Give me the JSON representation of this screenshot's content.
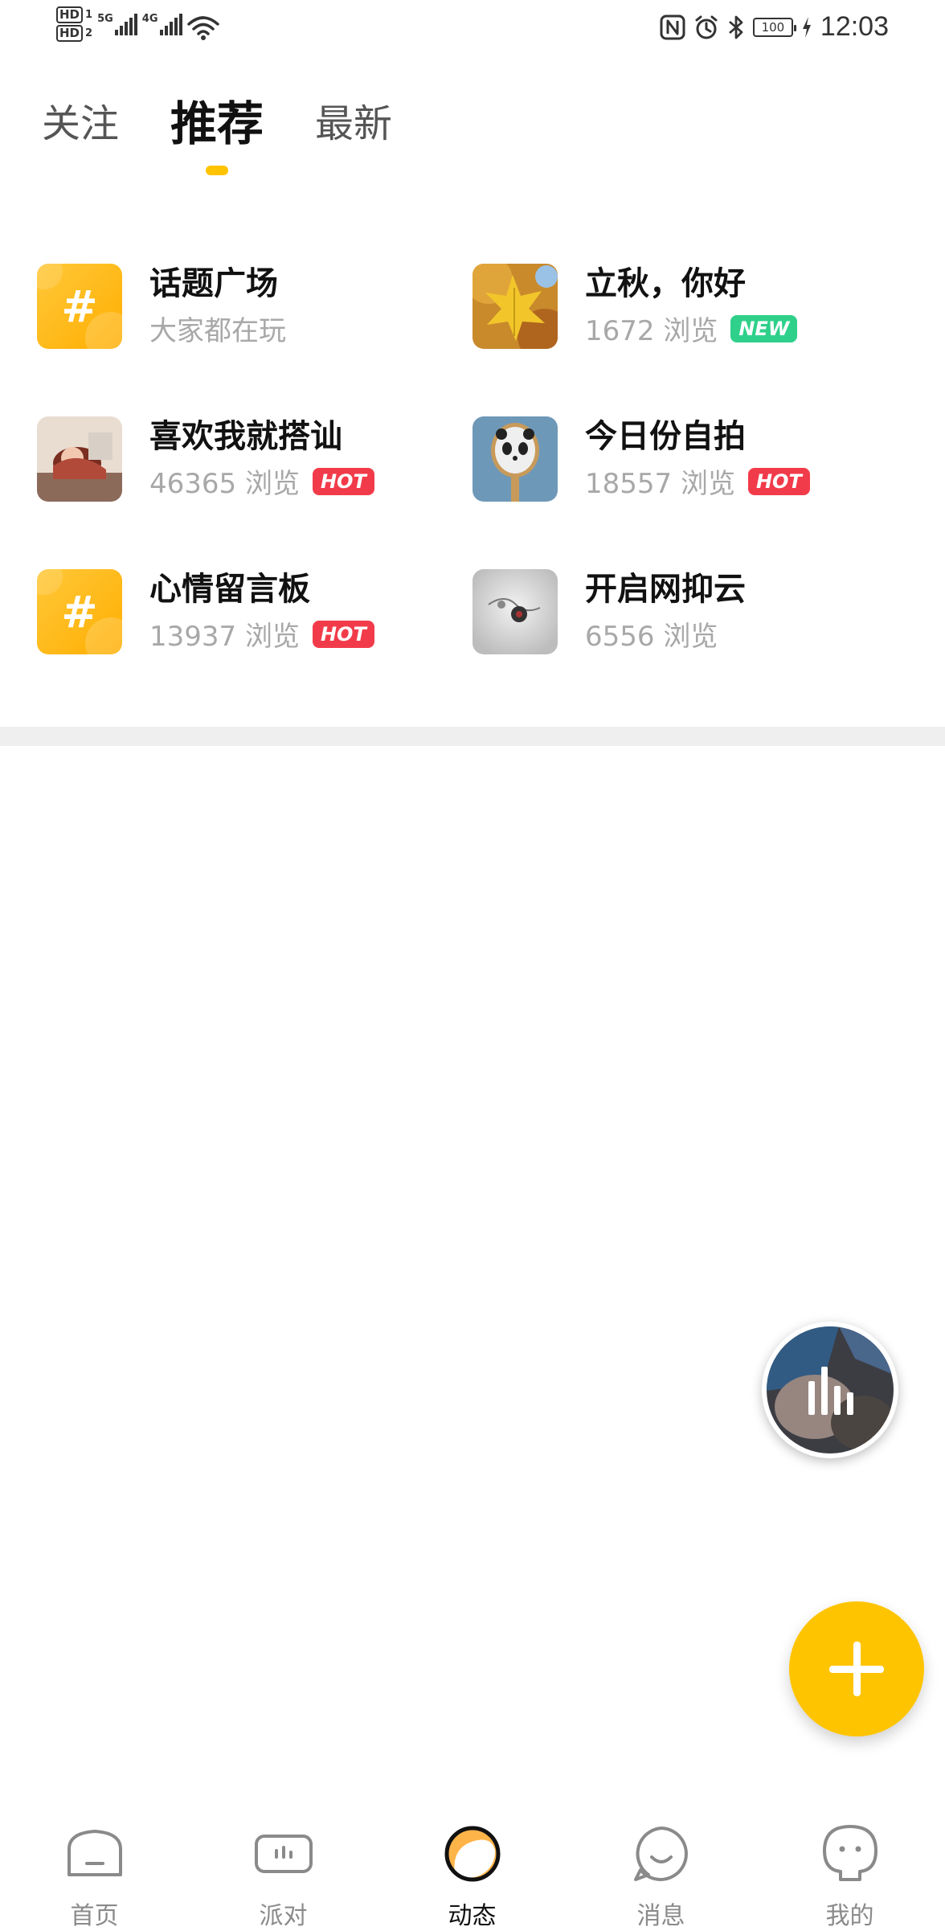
{
  "status_bar": {
    "hd1": "HD",
    "hd1_num": "1",
    "hd2": "HD",
    "hd2_num": "2",
    "net1": "5G",
    "net2": "4G",
    "battery": "100",
    "time": "12:03"
  },
  "tabs": [
    {
      "label": "关注",
      "active": false
    },
    {
      "label": "推荐",
      "active": true
    },
    {
      "label": "最新",
      "active": false
    }
  ],
  "topics": [
    {
      "title": "话题广场",
      "meta": "大家都在玩",
      "tag": null,
      "thumb": "hash-icon"
    },
    {
      "title": "立秋，你好",
      "meta": "1672 浏览",
      "tag": "NEW",
      "thumb": "autumn-leaves-image"
    },
    {
      "title": "喜欢我就搭讪",
      "meta": "46365 浏览",
      "tag": "HOT",
      "thumb": "girl-illustration-image"
    },
    {
      "title": "今日份自拍",
      "meta": "18557 浏览",
      "tag": "HOT",
      "thumb": "panda-mirror-image"
    },
    {
      "title": "心情留言板",
      "meta": "13937 浏览",
      "tag": "HOT",
      "thumb": "hash-icon"
    },
    {
      "title": "开启网抑云",
      "meta": "6556 浏览",
      "tag": null,
      "thumb": "earphones-image"
    }
  ],
  "bottom_nav": [
    {
      "label": "首页",
      "icon": "home-icon",
      "active": false
    },
    {
      "label": "派对",
      "icon": "party-icon",
      "active": false
    },
    {
      "label": "动态",
      "icon": "moments-icon",
      "active": true
    },
    {
      "label": "消息",
      "icon": "message-icon",
      "active": false
    },
    {
      "label": "我的",
      "icon": "profile-icon",
      "active": false
    }
  ],
  "colors": {
    "accent": "#FFC400",
    "hot_tag": "#F23B4A",
    "new_tag": "#2ED08A",
    "muted_text": "#A8A8A8"
  }
}
